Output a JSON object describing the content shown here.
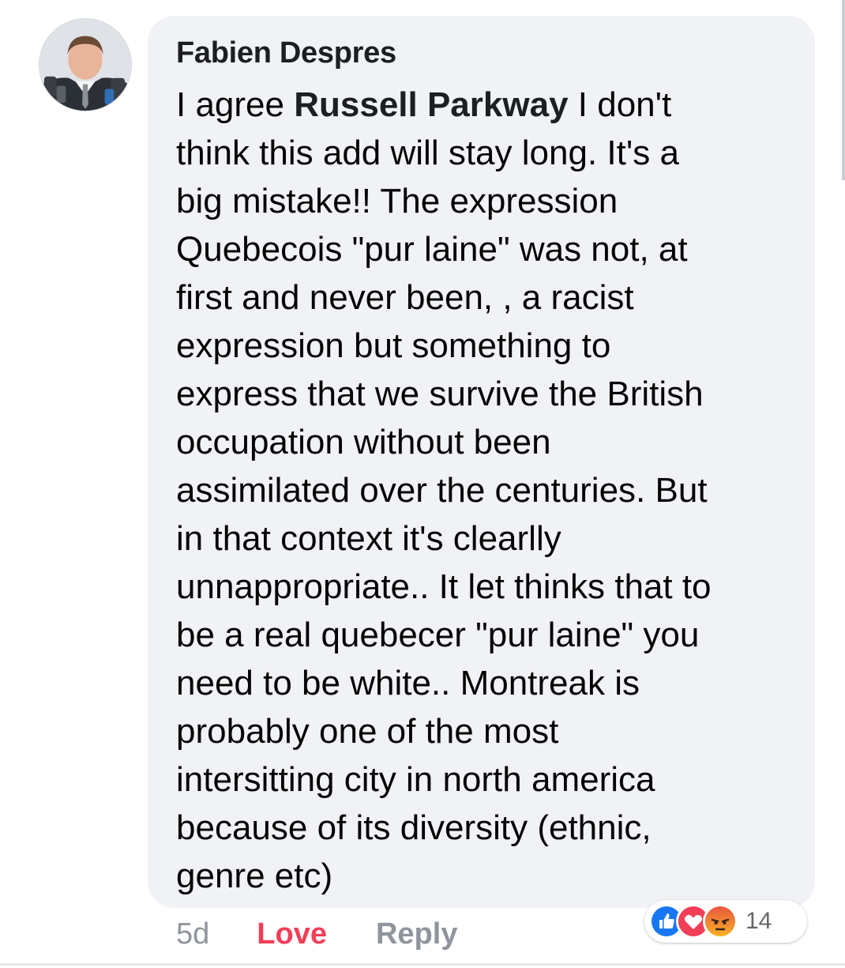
{
  "comment": {
    "author": "Fabien Despres",
    "prefix": "I agree ",
    "mention": "Russell Parkway",
    "text": "   I don't\nthink this add will stay long. It's a\nbig mistake!!  The expression\nQuebecois \"pur laine\" was not, at\nfirst and never been, , a racist\nexpression but something to\nexpress that we survive the British\noccupation without been\nassimilated over the centuries. But\nin that context  it's clearlly\nunnappropriate..  It let thinks that  to\nbe a real quebecer \"pur laine\" you\nneed to be white..  Montreak is\nprobably one of the most\nintersitting city in north america\nbecause of its diversity (ethnic,\ngenre etc)"
  },
  "actions": {
    "time": "5d",
    "love_label": "Love",
    "reply_label": "Reply"
  },
  "reactions": {
    "icons": [
      "like-icon",
      "love-icon",
      "angry-icon"
    ],
    "count": "14"
  },
  "colors": {
    "bubble": "#f0f2f5",
    "love": "#f33e58",
    "like": "#1877f2",
    "angry": "#f7b125",
    "muted": "#90949c"
  }
}
